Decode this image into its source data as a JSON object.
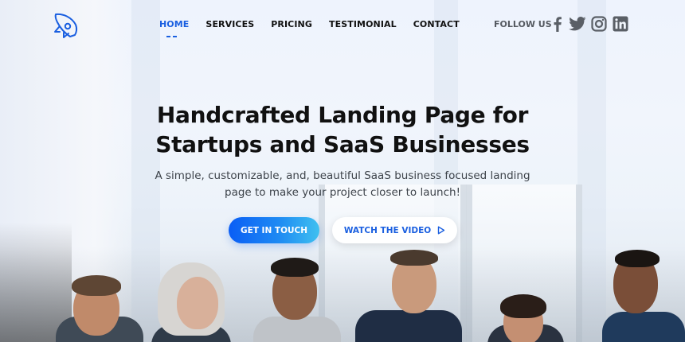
{
  "brand": {
    "logo_icon": "rocket-icon",
    "accent_color": "#1a5fe0"
  },
  "nav": {
    "items": [
      {
        "label": "HOME",
        "active": true
      },
      {
        "label": "SERVICES",
        "active": false
      },
      {
        "label": "PRICING",
        "active": false
      },
      {
        "label": "TESTIMONIAL",
        "active": false
      },
      {
        "label": "CONTACT",
        "active": false
      }
    ]
  },
  "social": {
    "label": "FOLLOW US",
    "icons": [
      "facebook-icon",
      "twitter-icon",
      "instagram-icon",
      "linkedin-icon"
    ]
  },
  "hero": {
    "headline_line1": "Handcrafted Landing Page for",
    "headline_line2": "Startups and SaaS Businesses",
    "subtext_line1": "A simple, customizable, and, beautiful SaaS business focused landing",
    "subtext_line2": "page to make your project closer to launch!",
    "primary_button": "GET IN TOUCH",
    "secondary_button": "WATCH THE VIDEO",
    "secondary_button_icon": "play-icon",
    "primary_gradient": [
      "#0a5ef5",
      "#3fc0f0"
    ]
  }
}
